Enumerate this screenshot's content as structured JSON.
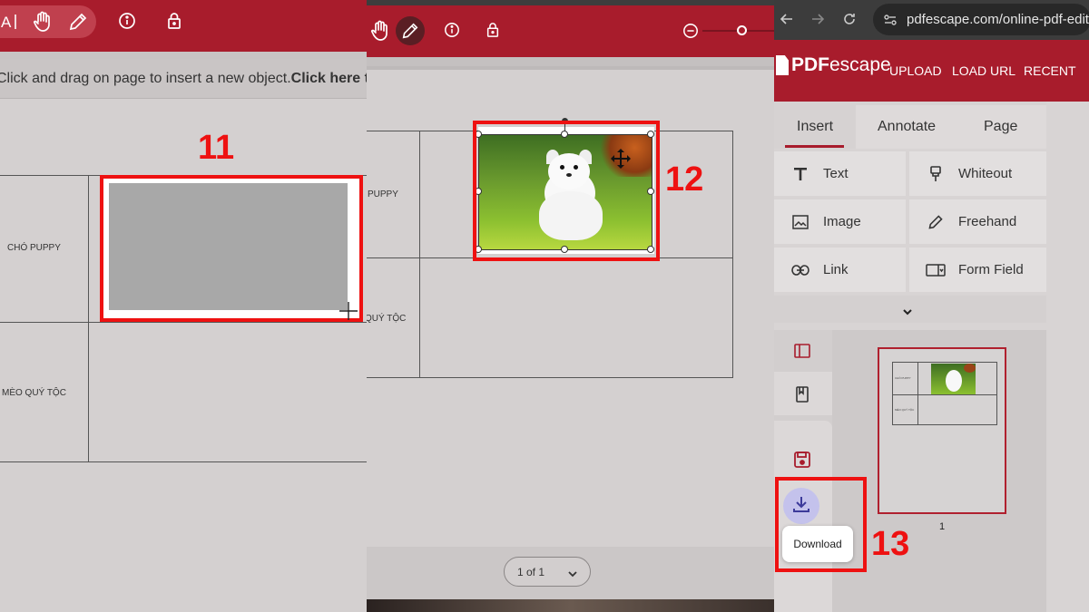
{
  "panel1": {
    "toolbar": {
      "icons": [
        "text-select-icon",
        "hand-icon",
        "pencil-icon",
        "info-icon",
        "lock-icon"
      ]
    },
    "hint": {
      "text": "Click and drag on page to insert a new object. ",
      "bold": "Click here to"
    },
    "step": "11",
    "table": {
      "row1": "CHÓ PUPPY",
      "row2": "MÈO QUÝ TỘC"
    }
  },
  "panel2": {
    "toolbar": {
      "icons": [
        "hand-icon",
        "pencil-icon",
        "info-icon",
        "lock-icon",
        "zoom-out-icon"
      ]
    },
    "step": "12",
    "table": {
      "row1": "PUPPY",
      "row2": "QUÝ TỘC"
    },
    "pager": {
      "label": "1 of 1"
    }
  },
  "panel3": {
    "browser": {
      "url": "pdfescape.com/online-pdf-edito"
    },
    "logo": {
      "part1": "PDF",
      "part2": "escape"
    },
    "nav": [
      "UPLOAD",
      "LOAD URL",
      "RECENT"
    ],
    "tabs": [
      "Insert",
      "Annotate",
      "Page"
    ],
    "active_tab": "Insert",
    "tools": [
      {
        "label": "Text",
        "icon": "text-t-icon"
      },
      {
        "label": "Whiteout",
        "icon": "whiteout-icon"
      },
      {
        "label": "Image",
        "icon": "image-icon"
      },
      {
        "label": "Freehand",
        "icon": "pencil-icon"
      },
      {
        "label": "Link",
        "icon": "link-icon"
      },
      {
        "label": "Form Field",
        "icon": "form-field-icon"
      }
    ],
    "thumbnail": {
      "page": "1",
      "row1": "CHÓ PUPPY",
      "row2": "MÈO QUÝ TỘC"
    },
    "download": {
      "tooltip": "Download"
    },
    "step": "13"
  },
  "colors": {
    "brand_red": "#a81c2c",
    "highlight_red": "#ee1111",
    "panel_bg": "#d4d0d0"
  }
}
